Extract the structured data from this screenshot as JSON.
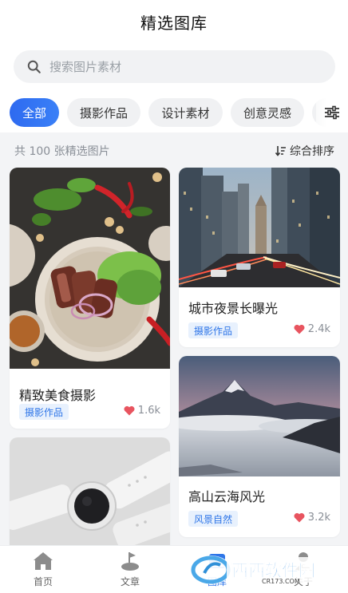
{
  "header": {
    "title": "精选图库"
  },
  "search": {
    "placeholder": "搜索图片素材"
  },
  "tabs": [
    {
      "label": "全部",
      "active": true
    },
    {
      "label": "摄影作品",
      "active": false
    },
    {
      "label": "设计素材",
      "active": false
    },
    {
      "label": "创意灵感",
      "active": false
    },
    {
      "label": "商",
      "active": false
    }
  ],
  "summary": {
    "count_text": "共 100 张精选图片",
    "sort_label": "综合排序"
  },
  "cards": [
    {
      "title": "精致美食摄影",
      "tag": "摄影作品",
      "likes": "1.6k"
    },
    {
      "title": "城市夜景长曝光",
      "tag": "摄影作品",
      "likes": "2.4k"
    },
    {
      "title": "高山云海风光",
      "tag": "风景自然",
      "likes": "3.2k"
    },
    {
      "title": "",
      "tag": "",
      "likes": ""
    }
  ],
  "bottom_nav": [
    {
      "label": "首页",
      "icon": "home-icon"
    },
    {
      "label": "文章",
      "icon": "article-icon"
    },
    {
      "label": "图库",
      "icon": "gallery-icon",
      "active": true
    },
    {
      "label": "关于",
      "icon": "user-icon"
    }
  ],
  "watermark": {
    "text": "西西软件园",
    "url_text": "CR173.COM"
  },
  "colors": {
    "accent": "#2f76e8",
    "heart": "#e8545f",
    "tag_bg": "#e8f1fd"
  }
}
